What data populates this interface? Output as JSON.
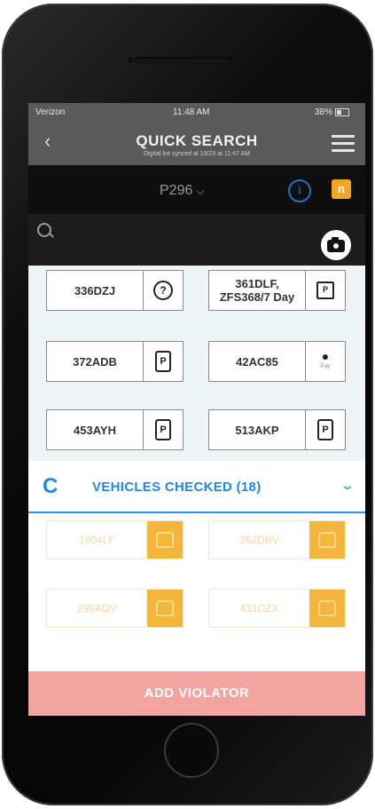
{
  "status_bar": {
    "carrier": "Verizon",
    "time": "11:48 AM",
    "battery": "38%"
  },
  "header": {
    "title": "QUICK SEARCH",
    "subtitle": "Digital list synced at 10/23 at 11:47 AM",
    "back_label": "‹"
  },
  "zone": {
    "selected": "P296",
    "chevron": "⌵"
  },
  "icons": {
    "info": "i",
    "n_badge": "n"
  },
  "plates": [
    {
      "plate": "336DZJ",
      "icon": "question-icon",
      "glyph": "?"
    },
    {
      "plate": "361DLF, ZFS368/7 Day",
      "icon": "calendar-icon",
      "glyph": "P"
    },
    {
      "plate": "372ADB",
      "icon": "phone-pay-icon",
      "glyph": "P"
    },
    {
      "plate": "42AC85",
      "icon": "apple-pay-icon",
      "glyph": "",
      "sub": "Pay"
    },
    {
      "plate": "453AYH",
      "icon": "phone-pay-icon",
      "glyph": "P"
    },
    {
      "plate": "513AKP",
      "icon": "phone-pay-icon",
      "glyph": "P"
    }
  ],
  "vehicles_checked": {
    "label": "VEHICLES CHECKED (18)",
    "chevron": "⌄",
    "refresh_glyph": "C"
  },
  "checked_plates": [
    "1004LF",
    "262DBV",
    "299ADV",
    "431CZX"
  ],
  "actions": {
    "add_violator": "ADD VIOLATOR"
  },
  "colors": {
    "accent_blue": "#1e88e5",
    "orange": "#f4b63a",
    "add_button": "#f3a3a0",
    "header": "#595959"
  }
}
